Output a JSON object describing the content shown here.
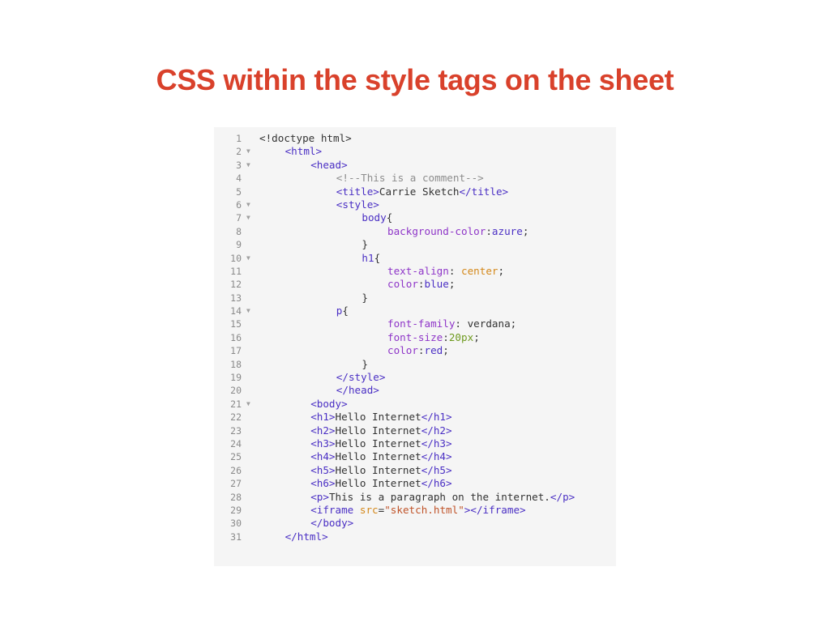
{
  "slide": {
    "title": "CSS within the style tags on the sheet"
  },
  "code": {
    "lines": [
      {
        "n": "1",
        "fold": false,
        "indent": 0,
        "tokens": [
          [
            "plain",
            "<!doctype html>"
          ]
        ]
      },
      {
        "n": "2",
        "fold": true,
        "indent": 1,
        "tokens": [
          [
            "tag",
            "<html>"
          ]
        ]
      },
      {
        "n": "3",
        "fold": true,
        "indent": 2,
        "tokens": [
          [
            "tag",
            "<head>"
          ]
        ]
      },
      {
        "n": "4",
        "fold": false,
        "indent": 3,
        "tokens": [
          [
            "comment",
            "<!--This is a comment-->"
          ]
        ]
      },
      {
        "n": "5",
        "fold": false,
        "indent": 3,
        "tokens": [
          [
            "tag",
            "<title>"
          ],
          [
            "plain",
            "Carrie Sketch"
          ],
          [
            "tag",
            "</title>"
          ]
        ]
      },
      {
        "n": "6",
        "fold": true,
        "indent": 3,
        "tokens": [
          [
            "tag",
            "<style>"
          ]
        ]
      },
      {
        "n": "7",
        "fold": true,
        "indent": 4,
        "tokens": [
          [
            "tag",
            "body"
          ],
          [
            "plain",
            "{"
          ]
        ]
      },
      {
        "n": "8",
        "fold": false,
        "indent": 5,
        "tokens": [
          [
            "prop",
            "background-color"
          ],
          [
            "plain",
            ":"
          ],
          [
            "val",
            "azure"
          ],
          [
            "plain",
            ";"
          ]
        ]
      },
      {
        "n": "9",
        "fold": false,
        "indent": 4,
        "tokens": [
          [
            "plain",
            "}"
          ]
        ]
      },
      {
        "n": "10",
        "fold": true,
        "indent": 4,
        "tokens": [
          [
            "tag",
            "h1"
          ],
          [
            "plain",
            "{"
          ]
        ]
      },
      {
        "n": "11",
        "fold": false,
        "indent": 5,
        "tokens": [
          [
            "prop",
            "text-align"
          ],
          [
            "plain",
            ": "
          ],
          [
            "kw",
            "center"
          ],
          [
            "plain",
            ";"
          ]
        ]
      },
      {
        "n": "12",
        "fold": false,
        "indent": 5,
        "tokens": [
          [
            "prop",
            "color"
          ],
          [
            "plain",
            ":"
          ],
          [
            "val",
            "blue"
          ],
          [
            "plain",
            ";"
          ]
        ]
      },
      {
        "n": "13",
        "fold": false,
        "indent": 4,
        "tokens": [
          [
            "plain",
            "}"
          ]
        ]
      },
      {
        "n": "14",
        "fold": true,
        "indent": 3,
        "tokens": [
          [
            "tag",
            "p"
          ],
          [
            "plain",
            "{"
          ]
        ]
      },
      {
        "n": "15",
        "fold": false,
        "indent": 5,
        "tokens": [
          [
            "prop",
            "font-family"
          ],
          [
            "plain",
            ": verdana;"
          ]
        ]
      },
      {
        "n": "16",
        "fold": false,
        "indent": 5,
        "tokens": [
          [
            "prop",
            "font-size"
          ],
          [
            "plain",
            ":"
          ],
          [
            "num",
            "20px"
          ],
          [
            "plain",
            ";"
          ]
        ]
      },
      {
        "n": "17",
        "fold": false,
        "indent": 5,
        "tokens": [
          [
            "prop",
            "color"
          ],
          [
            "plain",
            ":"
          ],
          [
            "val",
            "red"
          ],
          [
            "plain",
            ";"
          ]
        ]
      },
      {
        "n": "18",
        "fold": false,
        "indent": 4,
        "tokens": [
          [
            "plain",
            "}"
          ]
        ]
      },
      {
        "n": "19",
        "fold": false,
        "indent": 3,
        "tokens": [
          [
            "tag",
            "</style>"
          ]
        ]
      },
      {
        "n": "20",
        "fold": false,
        "indent": 3,
        "tokens": [
          [
            "tag",
            "</head>"
          ]
        ]
      },
      {
        "n": "21",
        "fold": true,
        "indent": 2,
        "tokens": [
          [
            "tag",
            "<body>"
          ]
        ]
      },
      {
        "n": "22",
        "fold": false,
        "indent": 2,
        "tokens": [
          [
            "tag",
            "<h1>"
          ],
          [
            "plain",
            "Hello Internet"
          ],
          [
            "tag",
            "</h1>"
          ]
        ]
      },
      {
        "n": "23",
        "fold": false,
        "indent": 2,
        "tokens": [
          [
            "tag",
            "<h2>"
          ],
          [
            "plain",
            "Hello Internet"
          ],
          [
            "tag",
            "</h2>"
          ]
        ]
      },
      {
        "n": "24",
        "fold": false,
        "indent": 2,
        "tokens": [
          [
            "tag",
            "<h3>"
          ],
          [
            "plain",
            "Hello Internet"
          ],
          [
            "tag",
            "</h3>"
          ]
        ]
      },
      {
        "n": "25",
        "fold": false,
        "indent": 2,
        "tokens": [
          [
            "tag",
            "<h4>"
          ],
          [
            "plain",
            "Hello Internet"
          ],
          [
            "tag",
            "</h4>"
          ]
        ]
      },
      {
        "n": "26",
        "fold": false,
        "indent": 2,
        "tokens": [
          [
            "tag",
            "<h5>"
          ],
          [
            "plain",
            "Hello Internet"
          ],
          [
            "tag",
            "</h5>"
          ]
        ]
      },
      {
        "n": "27",
        "fold": false,
        "indent": 2,
        "tokens": [
          [
            "tag",
            "<h6>"
          ],
          [
            "plain",
            "Hello Internet"
          ],
          [
            "tag",
            "</h6>"
          ]
        ]
      },
      {
        "n": "28",
        "fold": false,
        "indent": 2,
        "tokens": [
          [
            "tag",
            "<p>"
          ],
          [
            "plain",
            "This is a paragraph on the internet."
          ],
          [
            "tag",
            "</p>"
          ]
        ]
      },
      {
        "n": "29",
        "fold": false,
        "indent": 2,
        "tokens": [
          [
            "tag",
            "<iframe "
          ],
          [
            "kw",
            "src"
          ],
          [
            "plain",
            "="
          ],
          [
            "str",
            "\"sketch.html\""
          ],
          [
            "tag",
            ">"
          ],
          [
            "tag",
            "</iframe>"
          ]
        ]
      },
      {
        "n": "30",
        "fold": false,
        "indent": 2,
        "tokens": [
          [
            "tag",
            "</body>"
          ]
        ]
      },
      {
        "n": "31",
        "fold": false,
        "indent": 1,
        "tokens": [
          [
            "tag",
            "</html>"
          ]
        ]
      }
    ]
  },
  "colors": {
    "title": "#d9412b",
    "panel_bg": "#f5f5f5",
    "tag": "#4a2fc4",
    "property": "#8e35c8",
    "keyword": "#d4881a",
    "number": "#6e9a1e",
    "string": "#c0542a",
    "comment": "#8d8d8d"
  },
  "icons": {
    "fold_marker": "fold-triangle-icon"
  }
}
